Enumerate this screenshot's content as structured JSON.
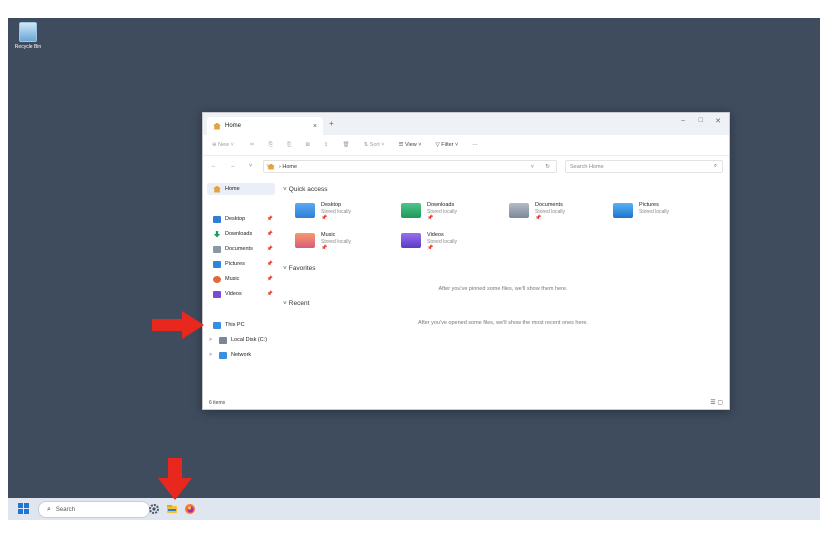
{
  "desktop": {
    "icons": [
      {
        "label": "Recycle Bin",
        "icon": "recycle-bin-icon"
      }
    ]
  },
  "explorer": {
    "tab_title": "Home",
    "tab_close": "×",
    "new_tab": "+",
    "window_controls": {
      "minimize": "–",
      "maximize": "□",
      "close": "✕"
    },
    "toolbar": {
      "new_label": "⊕ New ˅",
      "cut": "✂",
      "copy": "⎘",
      "paste": "⎗",
      "rename": "⊠",
      "share": "⇪",
      "delete": "🗑",
      "sort_label": "⇅ Sort ˅",
      "view_label": "☰ View ˅",
      "filter_label": "▽ Filter ˅",
      "more": "···"
    },
    "address": {
      "nav": "← → ˅ ↑",
      "path": "› Home",
      "dropdown": "˅",
      "refresh": "↻",
      "search_placeholder": "Search Home",
      "search_icon": "⌕"
    },
    "sidebar": {
      "home": "Home",
      "pinned": [
        {
          "label": "Desktop",
          "pin": "📌"
        },
        {
          "label": "Downloads",
          "pin": "📌"
        },
        {
          "label": "Documents",
          "pin": "📌"
        },
        {
          "label": "Pictures",
          "pin": "📌"
        },
        {
          "label": "Music",
          "pin": "📌"
        },
        {
          "label": "Videos",
          "pin": "📌"
        }
      ],
      "this_pc": "This PC",
      "local_disk": "Local Disk (C:)",
      "network": "Network",
      "chevron": ">"
    },
    "main": {
      "quick_access": {
        "header": "Quick access",
        "items": [
          {
            "name": "Desktop",
            "sub": "Stored locally",
            "pin": "📌"
          },
          {
            "name": "Downloads",
            "sub": "Stored locally",
            "pin": "📌"
          },
          {
            "name": "Documents",
            "sub": "Stored locally",
            "pin": "📌"
          },
          {
            "name": "Pictures",
            "sub": "Stored locally",
            "pin": "📌"
          },
          {
            "name": "Music",
            "sub": "Stored locally",
            "pin": "📌"
          },
          {
            "name": "Videos",
            "sub": "Stored locally",
            "pin": "📌"
          }
        ]
      },
      "favorites": {
        "header": "Favorites",
        "empty": "After you've pinned some files, we'll show them here."
      },
      "recent": {
        "header": "Recent",
        "empty": "After you've opened some files, we'll show the most recent ones here."
      },
      "chevron": "˅"
    },
    "status": {
      "count": "6 items",
      "views": "☰ ▢"
    }
  },
  "taskbar": {
    "search_placeholder": "Search",
    "search_icon": "⌕"
  },
  "colors": {
    "desktop_bg": "#3f4c5e",
    "taskbar_bg": "#dfe6ef",
    "accent": "#1f74d4",
    "annotation": "#e8281e"
  }
}
